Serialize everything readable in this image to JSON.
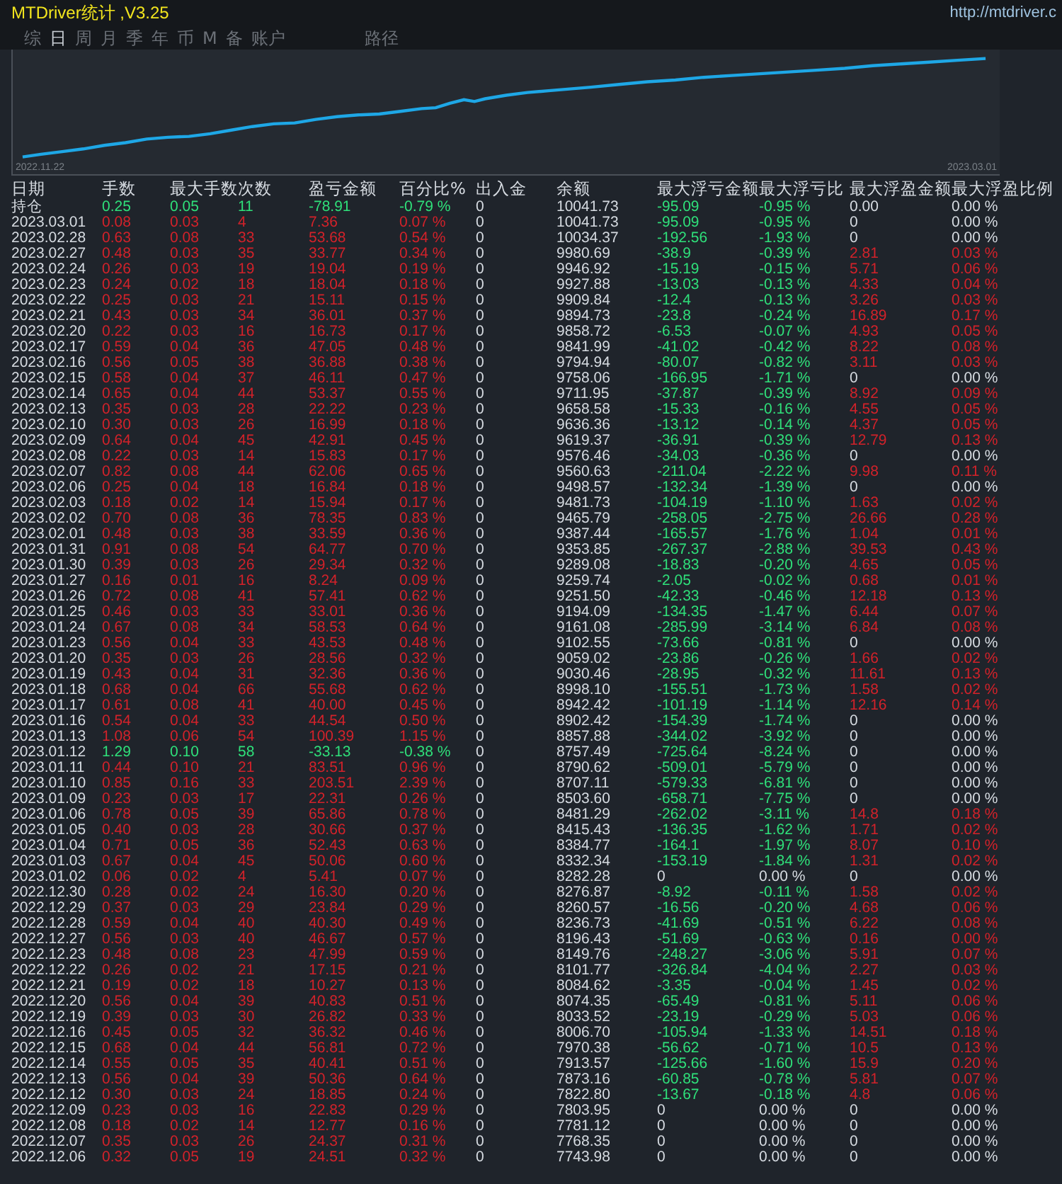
{
  "window": {
    "title": "MTDriver统计 ,V3.25",
    "url": "http://mtdriver.c"
  },
  "tabs": [
    {
      "label": "综",
      "selected": false
    },
    {
      "label": "日",
      "selected": true
    },
    {
      "label": "周",
      "selected": false
    },
    {
      "label": "月",
      "selected": false
    },
    {
      "label": "季",
      "selected": false
    },
    {
      "label": "年",
      "selected": false
    },
    {
      "label": "币",
      "selected": false
    },
    {
      "label": "M",
      "selected": false
    },
    {
      "label": "备",
      "selected": false
    },
    {
      "label": "账户",
      "selected": false
    },
    {
      "label": "路径",
      "selected": false
    }
  ],
  "chart": {
    "start_label": "2022.11.22",
    "end_label": "2023.03.01"
  },
  "table": {
    "columns": [
      "日期",
      "手数",
      "最大手数",
      "次数",
      "盈亏金额",
      "百分比%",
      "出入金",
      "余额",
      "最大浮亏金额",
      "最大浮亏比",
      "最大浮盈金额",
      "最大浮盈比例"
    ],
    "rows": [
      {
        "cells": [
          "持仓",
          "0.25",
          "0.05",
          "11",
          "-78.91",
          "-0.79 %",
          "0",
          "10041.73",
          "-95.09",
          "-0.95 %",
          "0.00",
          "0.00 %"
        ],
        "profit": false,
        "float_loss": true,
        "float_gain": false
      },
      {
        "cells": [
          "2023.03.01",
          "0.08",
          "0.03",
          "4",
          "7.36",
          "0.07 %",
          "0",
          "10041.73",
          "-95.09",
          "-0.95 %",
          "0",
          "0.00 %"
        ],
        "profit": true,
        "float_loss": true,
        "float_gain": false
      },
      {
        "cells": [
          "2023.02.28",
          "0.63",
          "0.08",
          "33",
          "53.68",
          "0.54 %",
          "0",
          "10034.37",
          "-192.56",
          "-1.93 %",
          "0",
          "0.00 %"
        ],
        "profit": true,
        "float_loss": true,
        "float_gain": false
      },
      {
        "cells": [
          "2023.02.27",
          "0.48",
          "0.03",
          "35",
          "33.77",
          "0.34 %",
          "0",
          "9980.69",
          "-38.9",
          "-0.39 %",
          "2.81",
          "0.03 %"
        ],
        "profit": true,
        "float_loss": true,
        "float_gain": true
      },
      {
        "cells": [
          "2023.02.24",
          "0.26",
          "0.03",
          "19",
          "19.04",
          "0.19 %",
          "0",
          "9946.92",
          "-15.19",
          "-0.15 %",
          "5.71",
          "0.06 %"
        ],
        "profit": true,
        "float_loss": true,
        "float_gain": true
      },
      {
        "cells": [
          "2023.02.23",
          "0.24",
          "0.02",
          "18",
          "18.04",
          "0.18 %",
          "0",
          "9927.88",
          "-13.03",
          "-0.13 %",
          "4.33",
          "0.04 %"
        ],
        "profit": true,
        "float_loss": true,
        "float_gain": true
      },
      {
        "cells": [
          "2023.02.22",
          "0.25",
          "0.03",
          "21",
          "15.11",
          "0.15 %",
          "0",
          "9909.84",
          "-12.4",
          "-0.13 %",
          "3.26",
          "0.03 %"
        ],
        "profit": true,
        "float_loss": true,
        "float_gain": true
      },
      {
        "cells": [
          "2023.02.21",
          "0.43",
          "0.03",
          "34",
          "36.01",
          "0.37 %",
          "0",
          "9894.73",
          "-23.8",
          "-0.24 %",
          "16.89",
          "0.17 %"
        ],
        "profit": true,
        "float_loss": true,
        "float_gain": true
      },
      {
        "cells": [
          "2023.02.20",
          "0.22",
          "0.03",
          "16",
          "16.73",
          "0.17 %",
          "0",
          "9858.72",
          "-6.53",
          "-0.07 %",
          "4.93",
          "0.05 %"
        ],
        "profit": true,
        "float_loss": true,
        "float_gain": true
      },
      {
        "cells": [
          "2023.02.17",
          "0.59",
          "0.04",
          "36",
          "47.05",
          "0.48 %",
          "0",
          "9841.99",
          "-41.02",
          "-0.42 %",
          "8.22",
          "0.08 %"
        ],
        "profit": true,
        "float_loss": true,
        "float_gain": true
      },
      {
        "cells": [
          "2023.02.16",
          "0.56",
          "0.05",
          "38",
          "36.88",
          "0.38 %",
          "0",
          "9794.94",
          "-80.07",
          "-0.82 %",
          "3.11",
          "0.03 %"
        ],
        "profit": true,
        "float_loss": true,
        "float_gain": true
      },
      {
        "cells": [
          "2023.02.15",
          "0.58",
          "0.04",
          "37",
          "46.11",
          "0.47 %",
          "0",
          "9758.06",
          "-166.95",
          "-1.71 %",
          "0",
          "0.00 %"
        ],
        "profit": true,
        "float_loss": true,
        "float_gain": false
      },
      {
        "cells": [
          "2023.02.14",
          "0.65",
          "0.04",
          "44",
          "53.37",
          "0.55 %",
          "0",
          "9711.95",
          "-37.87",
          "-0.39 %",
          "8.92",
          "0.09 %"
        ],
        "profit": true,
        "float_loss": true,
        "float_gain": true
      },
      {
        "cells": [
          "2023.02.13",
          "0.35",
          "0.03",
          "28",
          "22.22",
          "0.23 %",
          "0",
          "9658.58",
          "-15.33",
          "-0.16 %",
          "4.55",
          "0.05 %"
        ],
        "profit": true,
        "float_loss": true,
        "float_gain": true
      },
      {
        "cells": [
          "2023.02.10",
          "0.30",
          "0.03",
          "26",
          "16.99",
          "0.18 %",
          "0",
          "9636.36",
          "-13.12",
          "-0.14 %",
          "4.37",
          "0.05 %"
        ],
        "profit": true,
        "float_loss": true,
        "float_gain": true
      },
      {
        "cells": [
          "2023.02.09",
          "0.64",
          "0.04",
          "45",
          "42.91",
          "0.45 %",
          "0",
          "9619.37",
          "-36.91",
          "-0.39 %",
          "12.79",
          "0.13 %"
        ],
        "profit": true,
        "float_loss": true,
        "float_gain": true
      },
      {
        "cells": [
          "2023.02.08",
          "0.22",
          "0.03",
          "14",
          "15.83",
          "0.17 %",
          "0",
          "9576.46",
          "-34.03",
          "-0.36 %",
          "0",
          "0.00 %"
        ],
        "profit": true,
        "float_loss": true,
        "float_gain": false
      },
      {
        "cells": [
          "2023.02.07",
          "0.82",
          "0.08",
          "44",
          "62.06",
          "0.65 %",
          "0",
          "9560.63",
          "-211.04",
          "-2.22 %",
          "9.98",
          "0.11 %"
        ],
        "profit": true,
        "float_loss": true,
        "float_gain": true
      },
      {
        "cells": [
          "2023.02.06",
          "0.25",
          "0.04",
          "18",
          "16.84",
          "0.18 %",
          "0",
          "9498.57",
          "-132.34",
          "-1.39 %",
          "0",
          "0.00 %"
        ],
        "profit": true,
        "float_loss": true,
        "float_gain": false
      },
      {
        "cells": [
          "2023.02.03",
          "0.18",
          "0.02",
          "14",
          "15.94",
          "0.17 %",
          "0",
          "9481.73",
          "-104.19",
          "-1.10 %",
          "1.63",
          "0.02 %"
        ],
        "profit": true,
        "float_loss": true,
        "float_gain": true
      },
      {
        "cells": [
          "2023.02.02",
          "0.70",
          "0.08",
          "36",
          "78.35",
          "0.83 %",
          "0",
          "9465.79",
          "-258.05",
          "-2.75 %",
          "26.66",
          "0.28 %"
        ],
        "profit": true,
        "float_loss": true,
        "float_gain": true
      },
      {
        "cells": [
          "2023.02.01",
          "0.48",
          "0.03",
          "38",
          "33.59",
          "0.36 %",
          "0",
          "9387.44",
          "-165.57",
          "-1.76 %",
          "1.04",
          "0.01 %"
        ],
        "profit": true,
        "float_loss": true,
        "float_gain": true
      },
      {
        "cells": [
          "2023.01.31",
          "0.91",
          "0.08",
          "54",
          "64.77",
          "0.70 %",
          "0",
          "9353.85",
          "-267.37",
          "-2.88 %",
          "39.53",
          "0.43 %"
        ],
        "profit": true,
        "float_loss": true,
        "float_gain": true
      },
      {
        "cells": [
          "2023.01.30",
          "0.39",
          "0.03",
          "26",
          "29.34",
          "0.32 %",
          "0",
          "9289.08",
          "-18.83",
          "-0.20 %",
          "4.65",
          "0.05 %"
        ],
        "profit": true,
        "float_loss": true,
        "float_gain": true
      },
      {
        "cells": [
          "2023.01.27",
          "0.16",
          "0.01",
          "16",
          "8.24",
          "0.09 %",
          "0",
          "9259.74",
          "-2.05",
          "-0.02 %",
          "0.68",
          "0.01 %"
        ],
        "profit": true,
        "float_loss": true,
        "float_gain": true
      },
      {
        "cells": [
          "2023.01.26",
          "0.72",
          "0.08",
          "41",
          "57.41",
          "0.62 %",
          "0",
          "9251.50",
          "-42.33",
          "-0.46 %",
          "12.18",
          "0.13 %"
        ],
        "profit": true,
        "float_loss": true,
        "float_gain": true
      },
      {
        "cells": [
          "2023.01.25",
          "0.46",
          "0.03",
          "33",
          "33.01",
          "0.36 %",
          "0",
          "9194.09",
          "-134.35",
          "-1.47 %",
          "6.44",
          "0.07 %"
        ],
        "profit": true,
        "float_loss": true,
        "float_gain": true
      },
      {
        "cells": [
          "2023.01.24",
          "0.67",
          "0.08",
          "34",
          "58.53",
          "0.64 %",
          "0",
          "9161.08",
          "-285.99",
          "-3.14 %",
          "6.84",
          "0.08 %"
        ],
        "profit": true,
        "float_loss": true,
        "float_gain": true
      },
      {
        "cells": [
          "2023.01.23",
          "0.56",
          "0.04",
          "33",
          "43.53",
          "0.48 %",
          "0",
          "9102.55",
          "-73.66",
          "-0.81 %",
          "0",
          "0.00 %"
        ],
        "profit": true,
        "float_loss": true,
        "float_gain": false
      },
      {
        "cells": [
          "2023.01.20",
          "0.35",
          "0.03",
          "26",
          "28.56",
          "0.32 %",
          "0",
          "9059.02",
          "-23.86",
          "-0.26 %",
          "1.66",
          "0.02 %"
        ],
        "profit": true,
        "float_loss": true,
        "float_gain": true
      },
      {
        "cells": [
          "2023.01.19",
          "0.43",
          "0.04",
          "31",
          "32.36",
          "0.36 %",
          "0",
          "9030.46",
          "-28.95",
          "-0.32 %",
          "11.61",
          "0.13 %"
        ],
        "profit": true,
        "float_loss": true,
        "float_gain": true
      },
      {
        "cells": [
          "2023.01.18",
          "0.68",
          "0.04",
          "66",
          "55.68",
          "0.62 %",
          "0",
          "8998.10",
          "-155.51",
          "-1.73 %",
          "1.58",
          "0.02 %"
        ],
        "profit": true,
        "float_loss": true,
        "float_gain": true
      },
      {
        "cells": [
          "2023.01.17",
          "0.61",
          "0.08",
          "41",
          "40.00",
          "0.45 %",
          "0",
          "8942.42",
          "-101.19",
          "-1.14 %",
          "12.16",
          "0.14 %"
        ],
        "profit": true,
        "float_loss": true,
        "float_gain": true
      },
      {
        "cells": [
          "2023.01.16",
          "0.54",
          "0.04",
          "33",
          "44.54",
          "0.50 %",
          "0",
          "8902.42",
          "-154.39",
          "-1.74 %",
          "0",
          "0.00 %"
        ],
        "profit": true,
        "float_loss": true,
        "float_gain": false
      },
      {
        "cells": [
          "2023.01.13",
          "1.08",
          "0.06",
          "54",
          "100.39",
          "1.15 %",
          "0",
          "8857.88",
          "-344.02",
          "-3.92 %",
          "0",
          "0.00 %"
        ],
        "profit": true,
        "float_loss": true,
        "float_gain": false
      },
      {
        "cells": [
          "2023.01.12",
          "1.29",
          "0.10",
          "58",
          "-33.13",
          "-0.38 %",
          "0",
          "8757.49",
          "-725.64",
          "-8.24 %",
          "0",
          "0.00 %"
        ],
        "profit": false,
        "float_loss": true,
        "float_gain": false
      },
      {
        "cells": [
          "2023.01.11",
          "0.44",
          "0.10",
          "21",
          "83.51",
          "0.96 %",
          "0",
          "8790.62",
          "-509.01",
          "-5.79 %",
          "0",
          "0.00 %"
        ],
        "profit": true,
        "float_loss": true,
        "float_gain": false
      },
      {
        "cells": [
          "2023.01.10",
          "0.85",
          "0.16",
          "33",
          "203.51",
          "2.39 %",
          "0",
          "8707.11",
          "-579.33",
          "-6.81 %",
          "0",
          "0.00 %"
        ],
        "profit": true,
        "float_loss": true,
        "float_gain": false
      },
      {
        "cells": [
          "2023.01.09",
          "0.23",
          "0.03",
          "17",
          "22.31",
          "0.26 %",
          "0",
          "8503.60",
          "-658.71",
          "-7.75 %",
          "0",
          "0.00 %"
        ],
        "profit": true,
        "float_loss": true,
        "float_gain": false
      },
      {
        "cells": [
          "2023.01.06",
          "0.78",
          "0.05",
          "39",
          "65.86",
          "0.78 %",
          "0",
          "8481.29",
          "-262.02",
          "-3.11 %",
          "14.8",
          "0.18 %"
        ],
        "profit": true,
        "float_loss": true,
        "float_gain": true
      },
      {
        "cells": [
          "2023.01.05",
          "0.40",
          "0.03",
          "28",
          "30.66",
          "0.37 %",
          "0",
          "8415.43",
          "-136.35",
          "-1.62 %",
          "1.71",
          "0.02 %"
        ],
        "profit": true,
        "float_loss": true,
        "float_gain": true
      },
      {
        "cells": [
          "2023.01.04",
          "0.71",
          "0.05",
          "36",
          "52.43",
          "0.63 %",
          "0",
          "8384.77",
          "-164.1",
          "-1.97 %",
          "8.07",
          "0.10 %"
        ],
        "profit": true,
        "float_loss": true,
        "float_gain": true
      },
      {
        "cells": [
          "2023.01.03",
          "0.67",
          "0.04",
          "45",
          "50.06",
          "0.60 %",
          "0",
          "8332.34",
          "-153.19",
          "-1.84 %",
          "1.31",
          "0.02 %"
        ],
        "profit": true,
        "float_loss": true,
        "float_gain": true
      },
      {
        "cells": [
          "2023.01.02",
          "0.06",
          "0.02",
          "4",
          "5.41",
          "0.07 %",
          "0",
          "8282.28",
          "0",
          "0.00 %",
          "0",
          "0.00 %"
        ],
        "profit": true,
        "float_loss": false,
        "float_gain": false
      },
      {
        "cells": [
          "2022.12.30",
          "0.28",
          "0.02",
          "24",
          "16.30",
          "0.20 %",
          "0",
          "8276.87",
          "-8.92",
          "-0.11 %",
          "1.58",
          "0.02 %"
        ],
        "profit": true,
        "float_loss": true,
        "float_gain": true
      },
      {
        "cells": [
          "2022.12.29",
          "0.37",
          "0.03",
          "29",
          "23.84",
          "0.29 %",
          "0",
          "8260.57",
          "-16.56",
          "-0.20 %",
          "4.68",
          "0.06 %"
        ],
        "profit": true,
        "float_loss": true,
        "float_gain": true
      },
      {
        "cells": [
          "2022.12.28",
          "0.59",
          "0.04",
          "40",
          "40.30",
          "0.49 %",
          "0",
          "8236.73",
          "-41.69",
          "-0.51 %",
          "6.22",
          "0.08 %"
        ],
        "profit": true,
        "float_loss": true,
        "float_gain": true
      },
      {
        "cells": [
          "2022.12.27",
          "0.56",
          "0.03",
          "40",
          "46.67",
          "0.57 %",
          "0",
          "8196.43",
          "-51.69",
          "-0.63 %",
          "0.16",
          "0.00 %"
        ],
        "profit": true,
        "float_loss": true,
        "float_gain": true
      },
      {
        "cells": [
          "2022.12.23",
          "0.48",
          "0.08",
          "23",
          "47.99",
          "0.59 %",
          "0",
          "8149.76",
          "-248.27",
          "-3.06 %",
          "5.91",
          "0.07 %"
        ],
        "profit": true,
        "float_loss": true,
        "float_gain": true
      },
      {
        "cells": [
          "2022.12.22",
          "0.26",
          "0.02",
          "21",
          "17.15",
          "0.21 %",
          "0",
          "8101.77",
          "-326.84",
          "-4.04 %",
          "2.27",
          "0.03 %"
        ],
        "profit": true,
        "float_loss": true,
        "float_gain": true
      },
      {
        "cells": [
          "2022.12.21",
          "0.19",
          "0.02",
          "18",
          "10.27",
          "0.13 %",
          "0",
          "8084.62",
          "-3.35",
          "-0.04 %",
          "1.45",
          "0.02 %"
        ],
        "profit": true,
        "float_loss": true,
        "float_gain": true
      },
      {
        "cells": [
          "2022.12.20",
          "0.56",
          "0.04",
          "39",
          "40.83",
          "0.51 %",
          "0",
          "8074.35",
          "-65.49",
          "-0.81 %",
          "5.11",
          "0.06 %"
        ],
        "profit": true,
        "float_loss": true,
        "float_gain": true
      },
      {
        "cells": [
          "2022.12.19",
          "0.39",
          "0.03",
          "30",
          "26.82",
          "0.33 %",
          "0",
          "8033.52",
          "-23.19",
          "-0.29 %",
          "5.03",
          "0.06 %"
        ],
        "profit": true,
        "float_loss": true,
        "float_gain": true
      },
      {
        "cells": [
          "2022.12.16",
          "0.45",
          "0.05",
          "32",
          "36.32",
          "0.46 %",
          "0",
          "8006.70",
          "-105.94",
          "-1.33 %",
          "14.51",
          "0.18 %"
        ],
        "profit": true,
        "float_loss": true,
        "float_gain": true
      },
      {
        "cells": [
          "2022.12.15",
          "0.68",
          "0.04",
          "44",
          "56.81",
          "0.72 %",
          "0",
          "7970.38",
          "-56.62",
          "-0.71 %",
          "10.5",
          "0.13 %"
        ],
        "profit": true,
        "float_loss": true,
        "float_gain": true
      },
      {
        "cells": [
          "2022.12.14",
          "0.55",
          "0.05",
          "35",
          "40.41",
          "0.51 %",
          "0",
          "7913.57",
          "-125.66",
          "-1.60 %",
          "15.9",
          "0.20 %"
        ],
        "profit": true,
        "float_loss": true,
        "float_gain": true
      },
      {
        "cells": [
          "2022.12.13",
          "0.56",
          "0.04",
          "39",
          "50.36",
          "0.64 %",
          "0",
          "7873.16",
          "-60.85",
          "-0.78 %",
          "5.81",
          "0.07 %"
        ],
        "profit": true,
        "float_loss": true,
        "float_gain": true
      },
      {
        "cells": [
          "2022.12.12",
          "0.30",
          "0.03",
          "24",
          "18.85",
          "0.24 %",
          "0",
          "7822.80",
          "-13.67",
          "-0.18 %",
          "4.8",
          "0.06 %"
        ],
        "profit": true,
        "float_loss": true,
        "float_gain": true
      },
      {
        "cells": [
          "2022.12.09",
          "0.23",
          "0.03",
          "16",
          "22.83",
          "0.29 %",
          "0",
          "7803.95",
          "0",
          "0.00 %",
          "0",
          "0.00 %"
        ],
        "profit": true,
        "float_loss": false,
        "float_gain": false
      },
      {
        "cells": [
          "2022.12.08",
          "0.18",
          "0.02",
          "14",
          "12.77",
          "0.16 %",
          "0",
          "7781.12",
          "0",
          "0.00 %",
          "0",
          "0.00 %"
        ],
        "profit": true,
        "float_loss": false,
        "float_gain": false
      },
      {
        "cells": [
          "2022.12.07",
          "0.35",
          "0.03",
          "26",
          "24.37",
          "0.31 %",
          "0",
          "7768.35",
          "0",
          "0.00 %",
          "0",
          "0.00 %"
        ],
        "profit": true,
        "float_loss": false,
        "float_gain": false
      },
      {
        "cells": [
          "2022.12.06",
          "0.32",
          "0.05",
          "19",
          "24.51",
          "0.32 %",
          "0",
          "7743.98",
          "0",
          "0.00 %",
          "0",
          "0.00 %"
        ],
        "profit": true,
        "float_loss": false,
        "float_gain": false
      }
    ]
  }
}
